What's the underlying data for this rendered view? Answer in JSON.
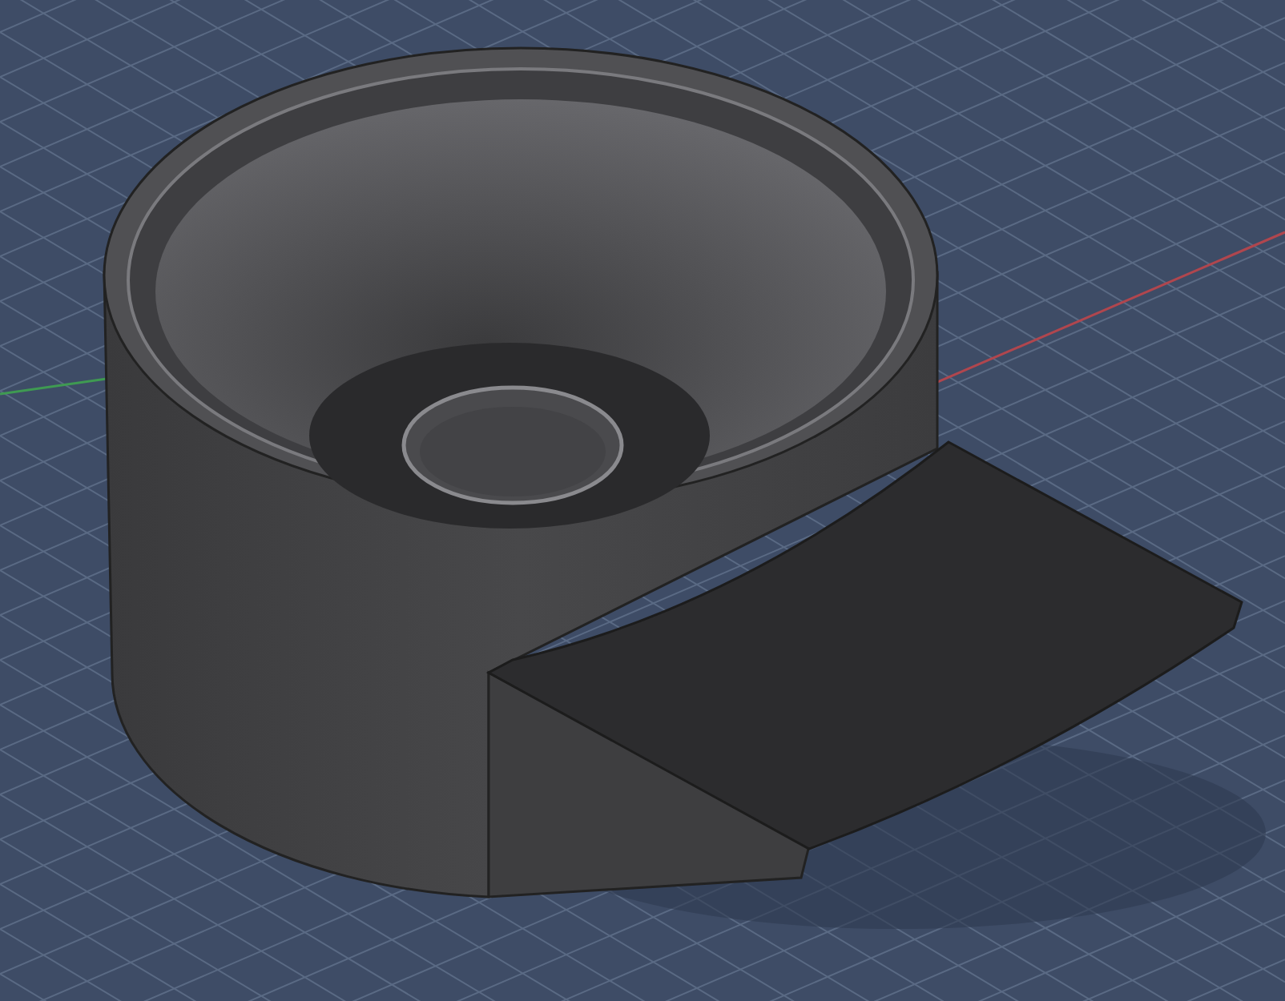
{
  "viewport": {
    "axes": [
      {
        "kind": "x",
        "color": "#b0464e"
      },
      {
        "kind": "y",
        "color": "#3f9a52"
      }
    ]
  }
}
